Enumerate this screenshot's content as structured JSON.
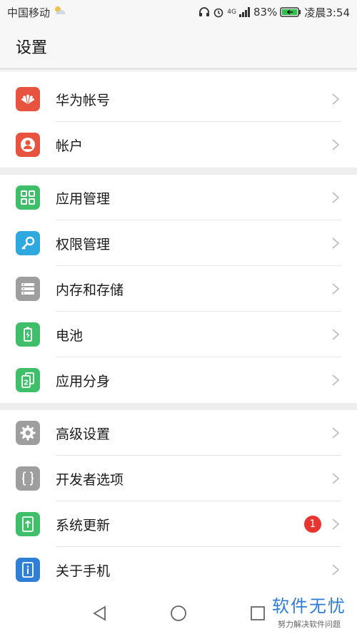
{
  "status": {
    "carrier": "中国移动",
    "network": "4G",
    "battery_percent": "83%",
    "time": "凌晨3:54"
  },
  "header": {
    "title": "设置"
  },
  "groups": [
    [
      {
        "label": "华为帐号",
        "icon": "huawei-logo-icon",
        "color": "#e8533f"
      },
      {
        "label": "帐户",
        "icon": "account-icon",
        "color": "#e8533f"
      }
    ],
    [
      {
        "label": "应用管理",
        "icon": "apps-grid-icon",
        "color": "#3fbf6a"
      },
      {
        "label": "权限管理",
        "icon": "key-icon",
        "color": "#2ea9e0"
      },
      {
        "label": "内存和存储",
        "icon": "storage-icon",
        "color": "#9e9e9e"
      },
      {
        "label": "电池",
        "icon": "battery-icon",
        "color": "#3fbf6a"
      },
      {
        "label": "应用分身",
        "icon": "app-twin-icon",
        "color": "#3fbf6a"
      }
    ],
    [
      {
        "label": "高级设置",
        "icon": "gear-icon",
        "color": "#9e9e9e"
      },
      {
        "label": "开发者选项",
        "icon": "braces-icon",
        "color": "#9e9e9e"
      },
      {
        "label": "系统更新",
        "icon": "system-update-icon",
        "color": "#3fbf6a",
        "badge": "1"
      },
      {
        "label": "关于手机",
        "icon": "info-icon",
        "color": "#2f7fd6"
      }
    ]
  ],
  "watermark": {
    "main": "软件无忧",
    "sub": "努力解决软件问题"
  }
}
